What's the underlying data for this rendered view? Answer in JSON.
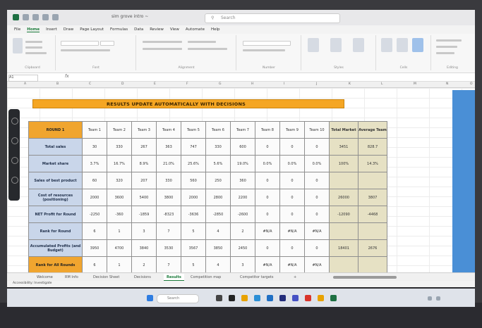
{
  "window": {
    "doc_title": "sim grove intro ~",
    "search_placeholder": "Search"
  },
  "ribbon": {
    "tabs": [
      "File",
      "Home",
      "Insert",
      "Draw",
      "Page Layout",
      "Formulas",
      "Data",
      "Review",
      "View",
      "Automate",
      "Help"
    ],
    "group_labels": [
      "Clipboard",
      "Font",
      "Alignment",
      "Number",
      "Styles",
      "Cells",
      "Editing"
    ]
  },
  "formula_bar": {
    "name_box": "A1",
    "fx": "fx"
  },
  "columns": [
    "A",
    "B",
    "C",
    "D",
    "E",
    "F",
    "G",
    "H",
    "I",
    "J",
    "K",
    "L",
    "M",
    "N",
    "O"
  ],
  "banner": "RESULTS UPDATE AUTOMATICALLY WITH DECISIONS",
  "table": {
    "round_header": "ROUND 1",
    "teams": [
      "Team 1",
      "Team 2",
      "Team 3",
      "Team 4",
      "Team 5",
      "Team 6",
      "Team 7",
      "Team 8",
      "Team 9",
      "Team 10"
    ],
    "total_header": "Total Market",
    "avg_header": "Average Team",
    "rows": [
      {
        "label": "Total sales",
        "values": [
          "30",
          "330",
          "267",
          "363",
          "747",
          "330",
          "600",
          "0",
          "0",
          "0"
        ],
        "total": "3451",
        "avg": "828.7"
      },
      {
        "label": "Market share",
        "values": [
          "3.7%",
          "16.7%",
          "8.9%",
          "21.0%",
          "25.6%",
          "5.6%",
          "19.0%",
          "0.0%",
          "0.0%",
          "0.0%"
        ],
        "total": "100%",
        "avg": "14.3%"
      },
      {
        "label": "Sales of best product",
        "values": [
          "60",
          "320",
          "207",
          "330",
          "560",
          "250",
          "360",
          "0",
          "0",
          "0"
        ],
        "total": "",
        "avg": ""
      },
      {
        "label": "Cost of resources (positioning)",
        "values": [
          "2000",
          "3600",
          "5400",
          "3800",
          "2000",
          "2800",
          "2200",
          "0",
          "0",
          "0"
        ],
        "total": "26000",
        "avg": "3807"
      },
      {
        "label": "NET Profit for Round",
        "values": [
          "-2250",
          "-360",
          "-1859",
          "-8323",
          "-3636",
          "-2850",
          "-2600",
          "0",
          "0",
          "0"
        ],
        "total": "-12090",
        "avg": "-4468"
      },
      {
        "label": "Rank for Round",
        "values": [
          "6",
          "1",
          "3",
          "7",
          "5",
          "4",
          "2",
          "#N/A",
          "#N/A",
          "#N/A"
        ],
        "total": "",
        "avg": ""
      },
      {
        "label": "Accumulated Profits (and Budget)",
        "values": [
          "3950",
          "4700",
          "3840",
          "3530",
          "3567",
          "3850",
          "2450",
          "0",
          "0",
          "0"
        ],
        "total": "18401",
        "avg": "2676"
      },
      {
        "label": "Rank for All Rounds",
        "values": [
          "6",
          "1",
          "2",
          "7",
          "5",
          "4",
          "3",
          "#N/A",
          "#N/A",
          "#N/A"
        ],
        "total": "",
        "avg": ""
      }
    ]
  },
  "sheet_tabs": [
    "Welcome",
    "RM Info",
    "Decision Sheet",
    "Decisions",
    "Results",
    "Competition map",
    "Competitor targets",
    "+"
  ],
  "active_sheet": "Results",
  "status": "Accessibility: Investigate",
  "taskbar": {
    "search_label": "Search"
  },
  "colors": {
    "banner": "#f5a623",
    "header": "#f0a52f",
    "row_label": "#c9d6ea",
    "totals": "#e6e1c4"
  }
}
